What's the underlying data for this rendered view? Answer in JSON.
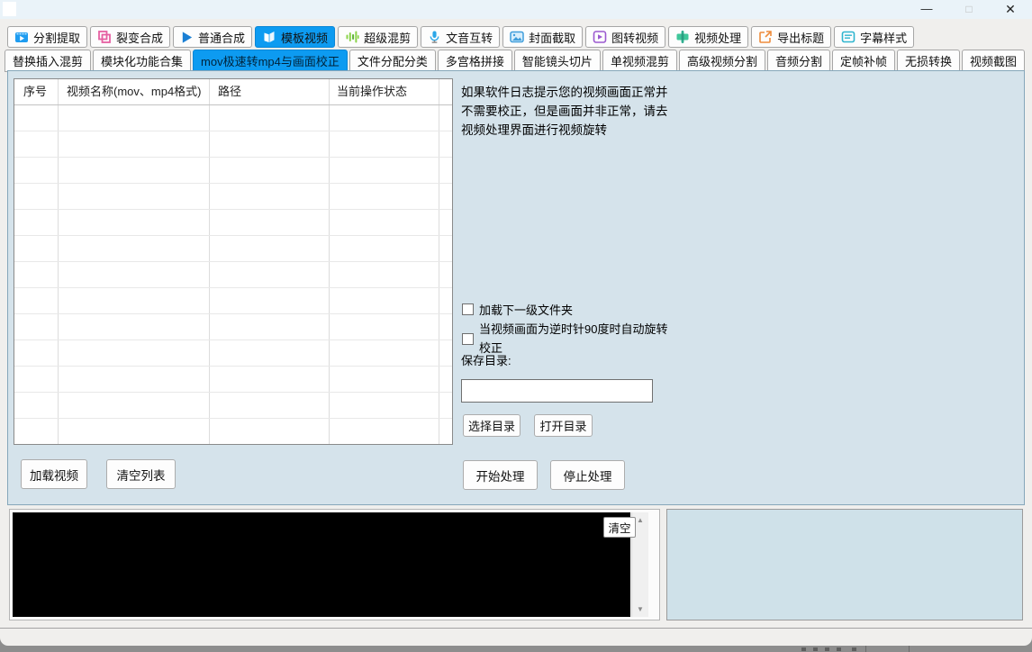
{
  "titlebar": {
    "icons": {
      "minimize": "—",
      "maximize": "□",
      "close": "✕"
    }
  },
  "tabs": {
    "row1": [
      {
        "label": "分割提取",
        "icon": "video-split-icon"
      },
      {
        "label": "裂变合成",
        "icon": "fission-squares-icon"
      },
      {
        "label": "普通合成",
        "icon": "play-triangle-icon"
      },
      {
        "label": "模板视频",
        "icon": "template-book-icon"
      },
      {
        "label": "超级混剪",
        "icon": "equalizer-icon"
      },
      {
        "label": "文音互转",
        "icon": "microphone-icon"
      },
      {
        "label": "封面截取",
        "icon": "image-icon"
      },
      {
        "label": "图转视频",
        "icon": "image-play-icon"
      },
      {
        "label": "视频处理",
        "icon": "film-process-icon"
      },
      {
        "label": "导出标题",
        "icon": "export-title-icon"
      },
      {
        "label": "字幕样式",
        "icon": "subtitle-style-icon"
      }
    ],
    "row1_selected": "模板视频",
    "row2": [
      {
        "label": "替换插入混剪"
      },
      {
        "label": "模块化功能合集"
      },
      {
        "label": "mov极速转mp4与画面校正"
      },
      {
        "label": "文件分配分类"
      },
      {
        "label": "多宫格拼接"
      },
      {
        "label": "智能镜头切片"
      },
      {
        "label": "单视频混剪"
      },
      {
        "label": "高级视频分割"
      },
      {
        "label": "音频分割"
      },
      {
        "label": "定帧补帧"
      },
      {
        "label": "无损转换"
      },
      {
        "label": "视频截图"
      }
    ],
    "row2_selected": "mov极速转mp4与画面校正"
  },
  "table": {
    "columns": [
      "序号",
      "视频名称(mov、mp4格式)",
      "路径",
      "当前操作状态"
    ],
    "rows": []
  },
  "panel": {
    "info_lines": [
      "如果软件日志提示您的视频画面正常并",
      "不需要校正，但是画面并非正常，请去",
      "视频处理界面进行视频旋转"
    ],
    "checkbox_load_subfolder": {
      "label": "加载下一级文件夹",
      "checked": false
    },
    "checkbox_auto_rotate": {
      "label": "当视频画面为逆时针90度时自动旋转校正",
      "checked": false
    },
    "save_dir_label": "保存目录:",
    "save_dir_value": "",
    "buttons": {
      "select_dir": "选择目录",
      "open_dir": "打开目录",
      "start": "开始处理",
      "stop": "停止处理"
    }
  },
  "list_buttons": {
    "load_video": "加载视频",
    "clear_list": "清空列表"
  },
  "log": {
    "clear": "清空",
    "content": "",
    "icons": {
      "scroll_up": "▲",
      "scroll_down": "▼"
    }
  },
  "colors": {
    "accent": "#0d9bf1",
    "tabpage_bg": "#d5e3eb",
    "bottom_panel_bg": "#cfe1e9",
    "log_bg": "#000000",
    "titlebar_bg": "#eaf3f9"
  }
}
